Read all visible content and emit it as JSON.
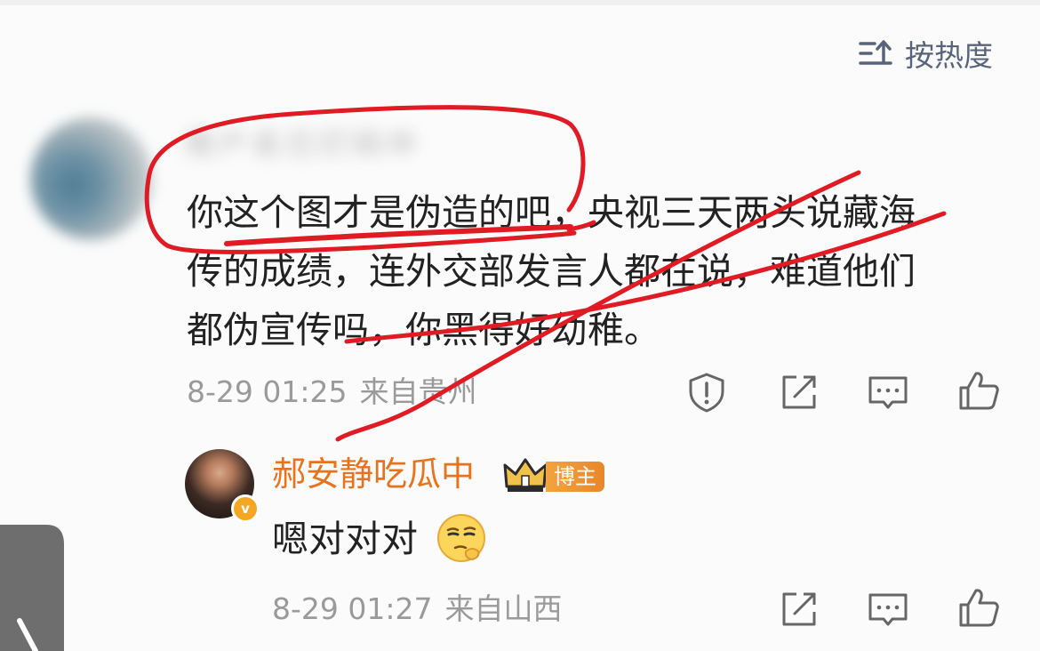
{
  "sort": {
    "label": "按热度",
    "icon": "sort-icon"
  },
  "comment": {
    "author_blurred": "用户名已打码中",
    "text_lines": [
      "你这个图才是伪造的吧，央视三天两头说藏海",
      "传的成绩，连外交部发言人都在说，难道他们",
      "都伪宣传吗，你黑得好幼稚。"
    ],
    "date": "8-29 01:25",
    "location": "来自贵州",
    "actions": [
      "report-icon",
      "share-icon",
      "comment-icon",
      "like-icon"
    ]
  },
  "reply": {
    "author": "郝安静吃瓜中",
    "badge": "博主",
    "verified_badge": "v",
    "text": "嗯对对对",
    "emoji": "thinking-face-emoji",
    "date": "8-29 01:27",
    "location": "来自山西",
    "actions": [
      "share-icon",
      "comment-icon",
      "like-icon"
    ]
  },
  "colors": {
    "accent_orange": "#e8731d",
    "annotation_red": "#e01b24",
    "meta_gray": "#9a9a9a",
    "text_main": "#222222",
    "sort_blue_gray": "#59647a"
  }
}
